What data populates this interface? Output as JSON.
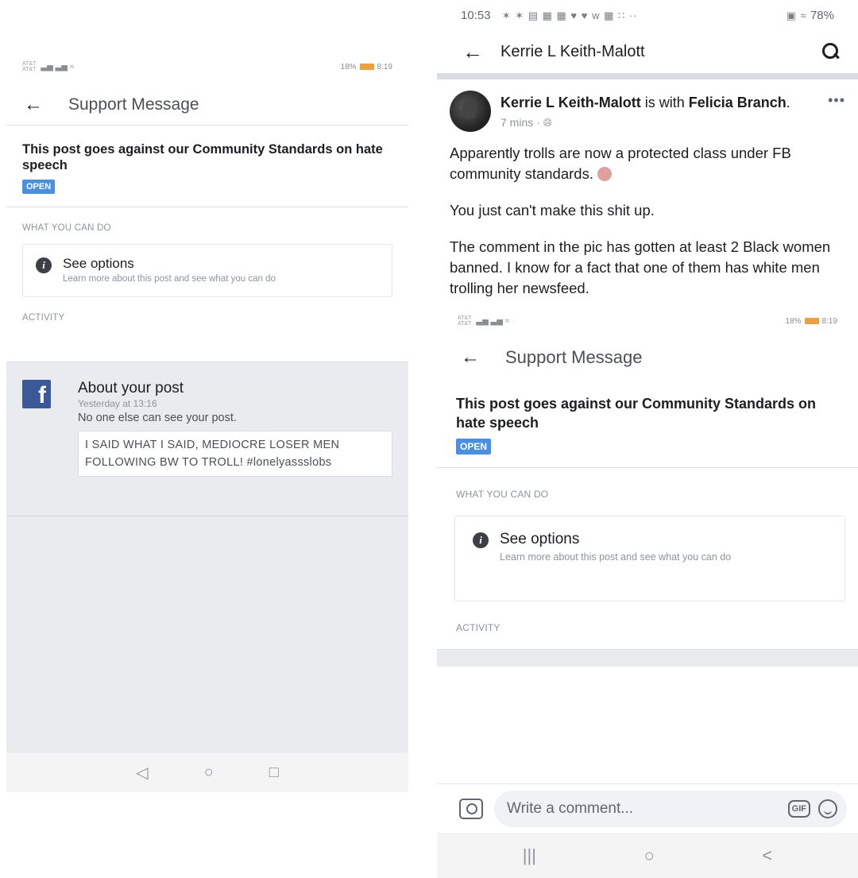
{
  "left_phone": {
    "status_bar": {
      "carrier_top": "AT&T",
      "carrier_bottom": "AT&T",
      "signal": "▃▅ ▃▅ ≈",
      "battery_text": "18%",
      "time": "8:19"
    },
    "app_bar": {
      "back_icon": "←",
      "title": "Support Message"
    },
    "message": {
      "headline": "This post goes against our Community Standards on hate speech",
      "status_badge": "OPEN"
    },
    "what_you_can_do": {
      "label": "WHAT YOU CAN DO",
      "option_title": "See options",
      "option_desc": "Learn more about this post and see what you can do"
    },
    "activity": {
      "label": "ACTIVITY",
      "item_title": "About your post",
      "item_time": "Yesterday at 13:16",
      "item_subtitle": "No one else can see your post.",
      "quoted_text": "I SAID WHAT I SAID, MEDIOCRE LOSER MEN FOLLOWING BW TO TROLL! #lonelyassslobs"
    },
    "nav": {
      "back": "◁",
      "home": "○",
      "recents": "□"
    }
  },
  "right_phone": {
    "status_bar": {
      "time": "10:53",
      "notif_icons": "✶ ✶ ▤ ▦ ▦ ♥ ♥ w ▦ ∷ ··",
      "right_icons": "▣ ≈",
      "battery": "78%"
    },
    "header": {
      "back_icon": "←",
      "name": "Kerrie L Keith-Malott"
    },
    "post": {
      "author": "Kerrie L Keith-Malott",
      "with_text": "is with",
      "tagged": "Felicia Branch",
      "time": "7 mins ·",
      "paragraph_1": "Apparently trolls are now a protected class under FB community standards.",
      "paragraph_2": "You just can't make this shit up.",
      "paragraph_3": "The comment in the pic has gotten at least 2 Black women banned. I know for a fact that one of them has white men trolling her newsfeed."
    },
    "comment_bar": {
      "placeholder": "Write a comment...",
      "gif_label": "GIF"
    },
    "nav": {
      "recents": "|||",
      "home": "○",
      "back": "<"
    }
  }
}
